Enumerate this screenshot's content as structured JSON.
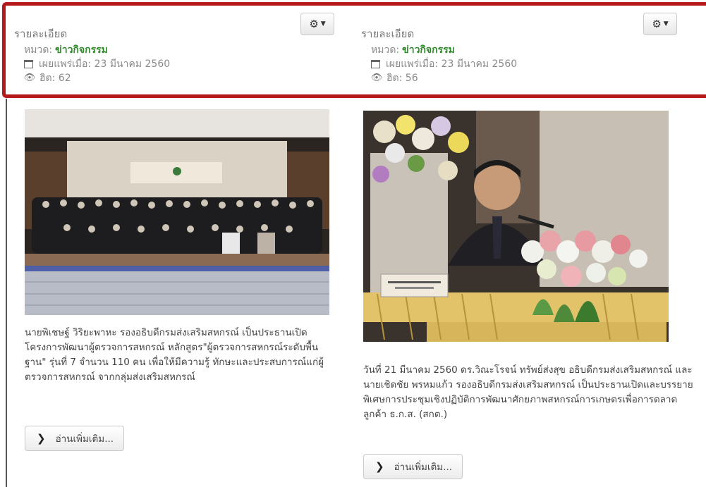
{
  "articles": [
    {
      "details_heading": "รายละเอียด",
      "category_label": "หมวด:",
      "category_value": "ข่าวกิจกรรม",
      "published": "เผยแพร่เมื่อ: 23 มีนาคม 2560",
      "hits": "ฮิต: 62",
      "image_alt": "group photo on stage",
      "description": "นายพิเชษฐ์ วิริยะพาหะ รองอธิบดีกรมส่งเสริมสหกรณ์ เป็นประธานเปิดโครงการพัฒนาผู้ตรวจการสหกรณ์ หลักสูตร\"ผู้ตรวจการสหกรณ์ระดับพื้นฐาน\" รุ่นที่ 7 จำนวน 110 คน เพื่อให้มีความรู้ ทักษะและประสบการณ์แก่ผู้ตรวจการสหกรณ์ จากกลุ่มส่งเสริมสหกรณ์",
      "read_more": "อ่านเพิ่มเติม..."
    },
    {
      "details_heading": "รายละเอียด",
      "category_label": "หมวด:",
      "category_value": "ข่าวกิจกรรม",
      "published": "เผยแพร่เมื่อ: 23 มีนาคม 2560",
      "hits": "ฮิต: 56",
      "image_alt": "speaker at podium with flowers",
      "description": "วันที่ 21 มีนาคม 2560 ดร.วิณะโรจน์ ทรัพย์ส่งสุข อธิบดีกรมส่งเสริมสหกรณ์ และนายเชิดชัย พรหมแก้ว รองอธิบดีกรมส่งเสริมสหกรณ์ เป็นประธานเปิดและบรรยายพิเศษการประชุมเชิงปฏิบัติการพัฒนาศักยภาพสหกรณ์การเกษตรเพื่อการตลาดลูกค้า ธ.ก.ส. (สกต.)",
      "read_more": "อ่านเพิ่มเติม..."
    }
  ],
  "icons": {
    "gear": "gear-icon",
    "caret": "caret-down-icon",
    "calendar": "calendar-icon",
    "eye": "eye-icon",
    "chevron": "chevron-right-icon"
  },
  "colors": {
    "highlight": "#b51a1a",
    "category": "#2f8a2a"
  }
}
